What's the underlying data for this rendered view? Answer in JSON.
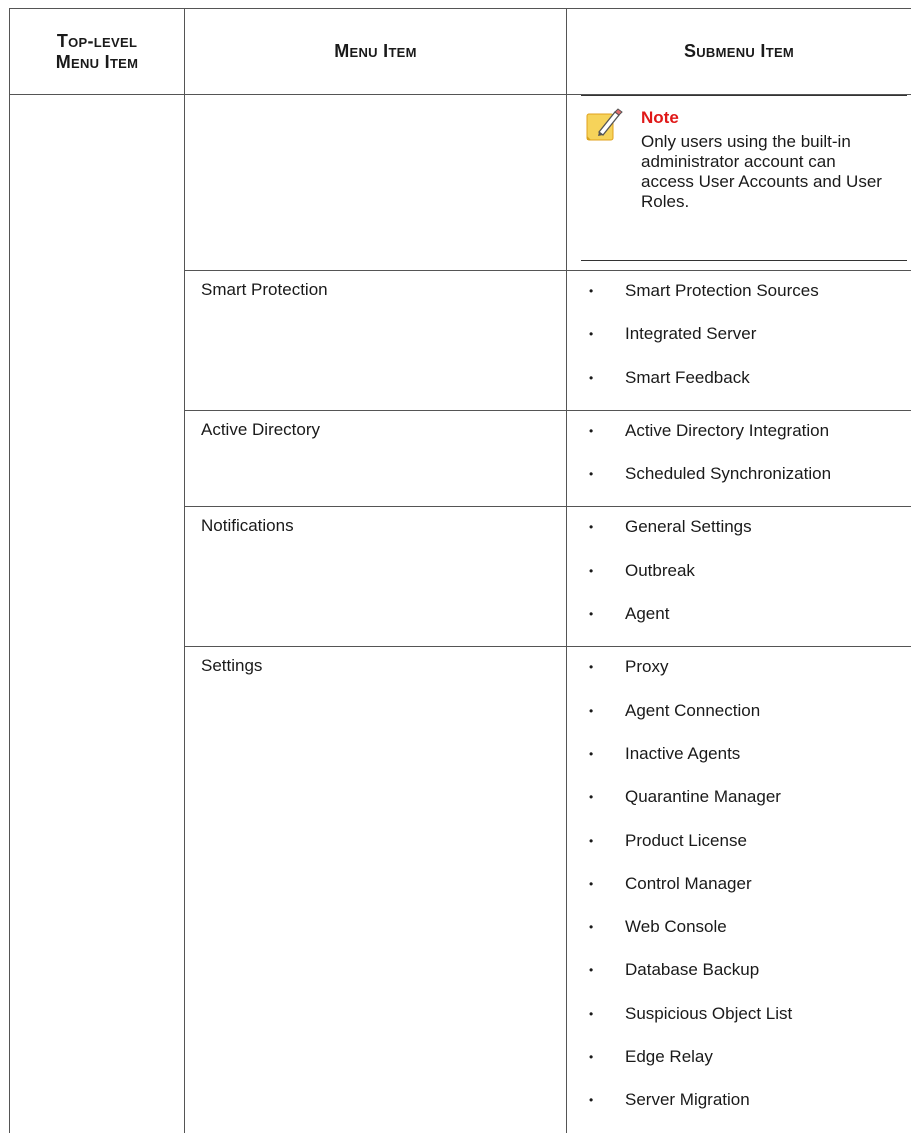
{
  "headers": {
    "top_level_line1": "Top-level",
    "top_level_line2": "Menu Item",
    "menu_item": "Menu Item",
    "submenu_item": "Submenu Item"
  },
  "note": {
    "icon": "note-pencil-icon",
    "title": "Note",
    "body": "Only users using the built-in administrator account can access User Accounts and User Roles.",
    "title_color": "#e01818"
  },
  "rows": [
    {
      "menu": "Smart Protection",
      "submenus": [
        "Smart Protection Sources",
        "Integrated Server",
        "Smart Feedback"
      ]
    },
    {
      "menu": "Active Directory",
      "submenus": [
        "Active Directory Integration",
        "Scheduled Synchronization"
      ]
    },
    {
      "menu": "Notifications",
      "submenus": [
        "General Settings",
        "Outbreak",
        "Agent"
      ]
    },
    {
      "menu": "Settings",
      "submenus": [
        "Proxy",
        "Agent Connection",
        "Inactive Agents",
        "Quarantine Manager",
        "Product License",
        "Control Manager",
        "Web Console",
        "Database Backup",
        "Suspicious Object List",
        "Edge Relay",
        "Server Migration"
      ]
    }
  ],
  "bullet_char": "•"
}
